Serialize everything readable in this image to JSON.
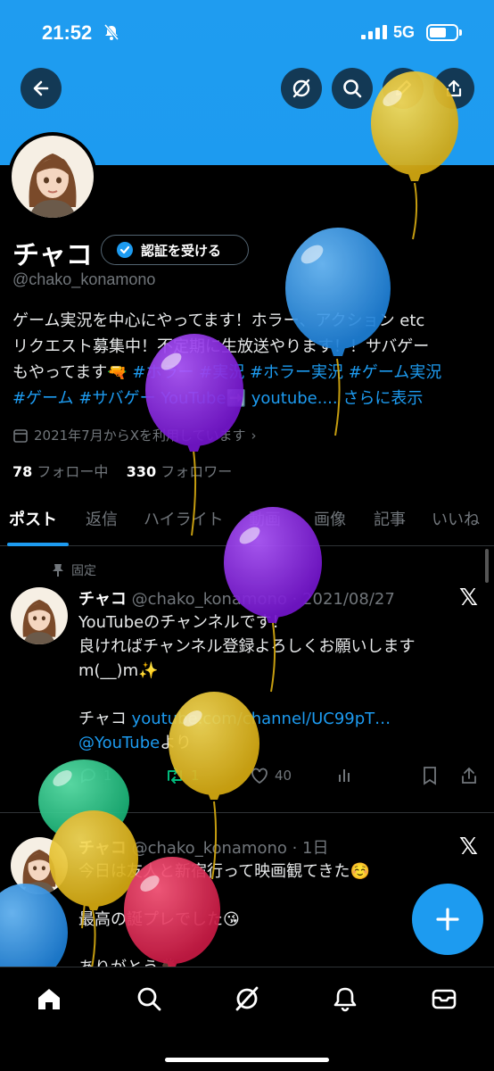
{
  "status_bar": {
    "time": "21:52",
    "network": "5G"
  },
  "profile": {
    "display_name": "チャコ",
    "verify_label": "認証を受ける",
    "handle": "@chako_konamono",
    "bio_line1": "ゲーム実況を中心にやってます！ホラー、アクション etc",
    "bio_line2": "リクエスト募集中！不定期に生放送やります！！サバゲー",
    "bio_line3_text": "もやってます🔫",
    "bio_tags_line3": "#ホラー #実況 #ホラー実況 #ゲーム実況",
    "bio_tags_line4": "#ゲーム #サバゲー YouTube➡️",
    "bio_link": "youtube....",
    "show_more": "さらに表示",
    "joined": "2021年7月からXを利用しています",
    "following_count": "78",
    "following_label": "フォロー中",
    "followers_count": "330",
    "followers_label": "フォロワー"
  },
  "tabs": [
    "ポスト",
    "返信",
    "ハイライト",
    "動画",
    "画像",
    "記事",
    "いいね"
  ],
  "pinned_label": "固定",
  "tweets": [
    {
      "name": "チャコ",
      "handle_date": "@chako_konamono · 2021/08/27",
      "line1": "YouTubeのチャンネルです！",
      "line2": "良ければチャンネル登録よろしくお願いします",
      "line3": "m(__)m✨",
      "line4_prefix": "チャコ ",
      "line4_link": "youtube.com/channel/UC99pT…",
      "line5_link": "@YouTube",
      "line5_suffix": "より",
      "replies": "1",
      "retweets": "1",
      "likes": "40"
    },
    {
      "name": "チャコ",
      "handle_date": "@chako_konamono · 1日",
      "line1": "今日は友人と新宿行って映画観てきた☺️",
      "line2": "最高の誕プレでした😘",
      "line3": "ありがとう🙇"
    }
  ],
  "colors": {
    "accent": "#1d9bf0",
    "retweet": "#00ba7c",
    "balloon_yellow": "#e8c02a",
    "balloon_blue": "#3a9bea",
    "balloon_purple": "#8a2be2",
    "balloon_green": "#2ec98a",
    "balloon_red": "#e0365a"
  },
  "icons": [
    "back-arrow-icon",
    "grok-icon",
    "search-icon",
    "edit-icon",
    "share-icon",
    "verified-badge-icon",
    "calendar-icon",
    "pin-icon",
    "x-logo-icon",
    "reply-icon",
    "retweet-icon",
    "like-icon",
    "views-icon",
    "bookmark-icon",
    "home-icon",
    "notifications-icon",
    "messages-icon",
    "compose-icon"
  ]
}
